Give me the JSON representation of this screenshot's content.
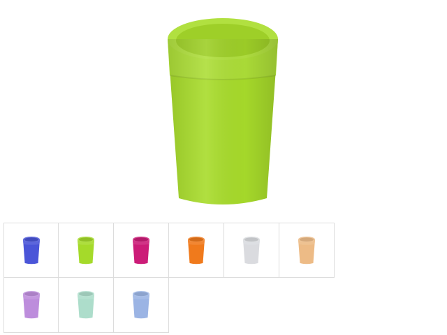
{
  "main_image": {
    "icon": "cup-icon",
    "color": "#a8dc2b"
  },
  "thumbnails": [
    {
      "icon": "cup-icon",
      "color": "#4a55d8",
      "opacity": 1
    },
    {
      "icon": "cup-icon",
      "color": "#a5da2a",
      "opacity": 1
    },
    {
      "icon": "cup-icon",
      "color": "#cc1c78",
      "opacity": 1
    },
    {
      "icon": "cup-icon",
      "color": "#f07a1c",
      "opacity": 1
    },
    {
      "icon": "cup-icon",
      "color": "#d6d8dc",
      "opacity": 0.9
    },
    {
      "icon": "cup-icon",
      "color": "#eab072",
      "opacity": 0.85
    },
    {
      "icon": "cup-icon",
      "color": "#b27ad6",
      "opacity": 0.85
    },
    {
      "icon": "cup-icon",
      "color": "#9fd8c2",
      "opacity": 0.85
    },
    {
      "icon": "cup-icon",
      "color": "#8aa8e0",
      "opacity": 0.85
    }
  ]
}
